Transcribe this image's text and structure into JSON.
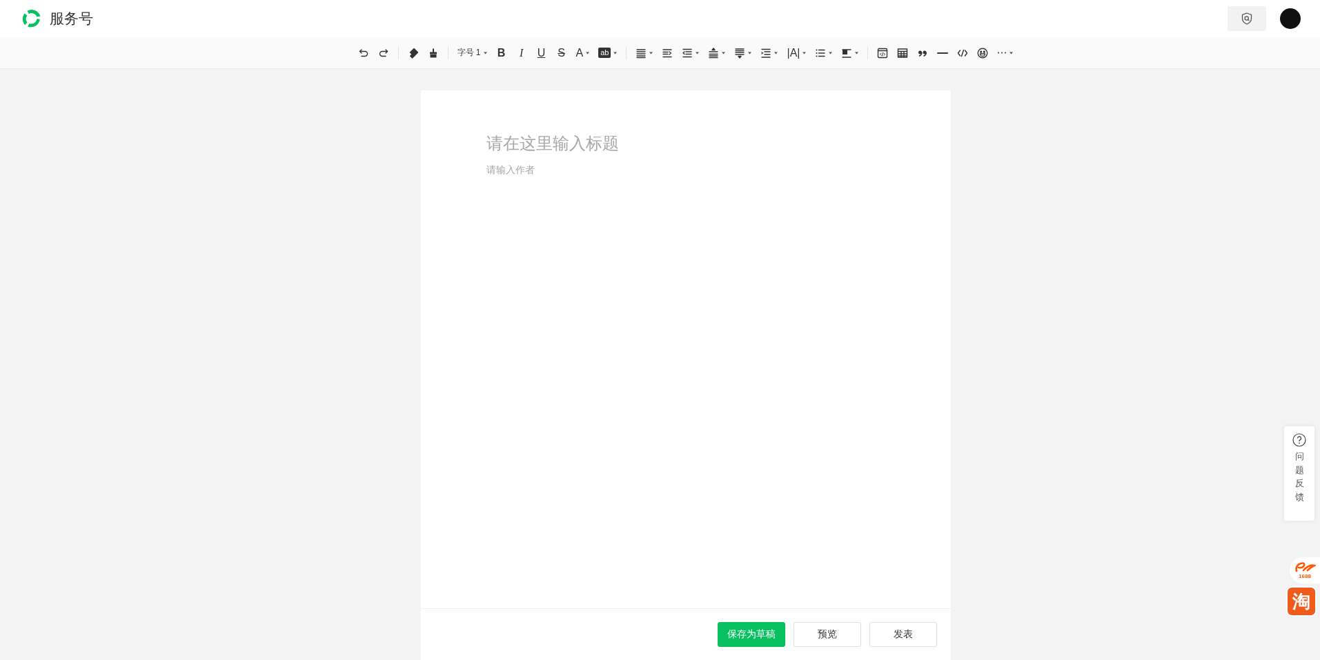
{
  "header": {
    "title": "服务号"
  },
  "toolbar": {
    "items": [
      {
        "kind": "icon"
      },
      {
        "kind": "icon"
      },
      {
        "kind": "separator"
      },
      {
        "kind": "icon"
      },
      {
        "kind": "icon"
      },
      {
        "kind": "separator"
      },
      {
        "kind": "label-dropdown",
        "label": "字号 1"
      },
      {
        "kind": "glyph",
        "label": "B"
      },
      {
        "kind": "glyph",
        "label": "I"
      },
      {
        "kind": "glyph",
        "label": "U"
      },
      {
        "kind": "glyph",
        "label": "S"
      },
      {
        "kind": "glyph-dropdown",
        "label": "A"
      },
      {
        "kind": "glyph-dropdown",
        "label": "ab"
      },
      {
        "kind": "separator"
      },
      {
        "kind": "dropdown"
      },
      {
        "kind": "icon"
      },
      {
        "kind": "dropdown"
      },
      {
        "kind": "dropdown"
      },
      {
        "kind": "dropdown"
      },
      {
        "kind": "dropdown"
      },
      {
        "kind": "glyph-dropdown",
        "label": "|A|"
      },
      {
        "kind": "dropdown"
      },
      {
        "kind": "dropdown"
      },
      {
        "kind": "separator"
      },
      {
        "kind": "icon"
      },
      {
        "kind": "icon"
      },
      {
        "kind": "icon"
      },
      {
        "kind": "icon"
      },
      {
        "kind": "icon"
      },
      {
        "kind": "icon"
      },
      {
        "kind": "dropdown"
      }
    ]
  },
  "editor": {
    "title_placeholder": "请在这里输入标题",
    "author_placeholder": "请输入作者"
  },
  "footer_buttons": [
    {
      "label": "保存为草稿",
      "kind": "primary"
    },
    {
      "label": "预览",
      "kind": "default"
    },
    {
      "label": "发表",
      "kind": "default"
    }
  ],
  "feedback": {
    "label": "问题反馈"
  },
  "side_apps": [
    {
      "label": "1688",
      "kind": "swoosh"
    },
    {
      "label": "淘",
      "kind": "tile"
    }
  ]
}
